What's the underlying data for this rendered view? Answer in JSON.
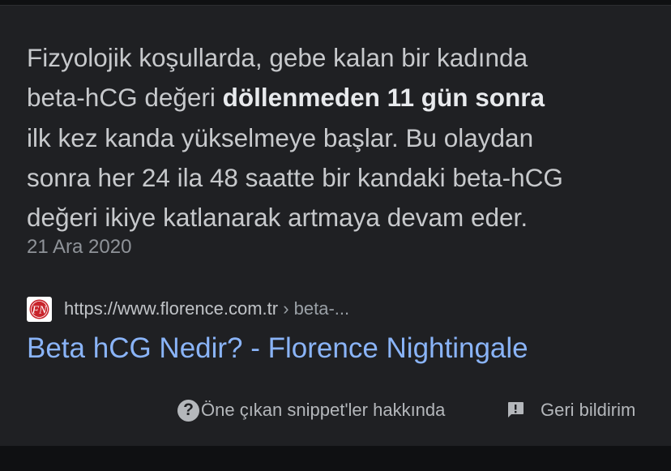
{
  "snippet": {
    "line1": "Fizyolojik koşullarda, gebe kalan bir kadında",
    "line2_before": "beta-hCG değeri ",
    "line2_bold": "döllenmeden 11 gün sonra",
    "line3": "ilk kez kanda yükselmeye başlar. Bu olaydan",
    "line4": "sonra her 24 ila 48 saatte bir kandaki beta-hCG",
    "line5": "değeri ikiye katlanarak artmaya devam eder."
  },
  "date": "21 Ara 2020",
  "source": {
    "url": "https://www.florence.com.tr",
    "breadcrumb": " › beta-...",
    "favicon_letters": "FN",
    "favicon_color": "#c8242b"
  },
  "result_title": "Beta hCG Nedir? - Florence Nightingale",
  "footer": {
    "about_label": "Öne çıkan snippet'ler hakkında",
    "about_icon_glyph": "?",
    "feedback_label": "Geri bildirim"
  },
  "icons": {
    "about": "help-circle-icon",
    "feedback": "feedback-icon"
  },
  "colors": {
    "link": "#8ab4f8",
    "background": "#1f2023",
    "text": "#c7c9cc"
  }
}
